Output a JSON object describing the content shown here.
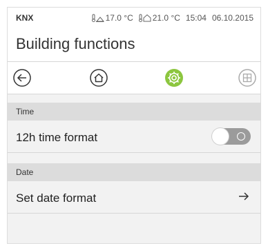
{
  "status_bar": {
    "brand": "KNX",
    "outdoor_temp": "17.0 °C",
    "indoor_temp": "21.0 °C",
    "time": "15:04",
    "date": "06.10.2015"
  },
  "header": {
    "title": "Building functions"
  },
  "nav": {
    "icons": [
      "back-arrow-icon",
      "home-icon",
      "settings-gear-icon",
      "grid-icon"
    ],
    "active_color": "#8cc63f"
  },
  "sections": {
    "time": {
      "header": "Time",
      "row_label": "12h time format",
      "toggle_on": false
    },
    "date": {
      "header": "Date",
      "row_label": "Set date format"
    }
  }
}
